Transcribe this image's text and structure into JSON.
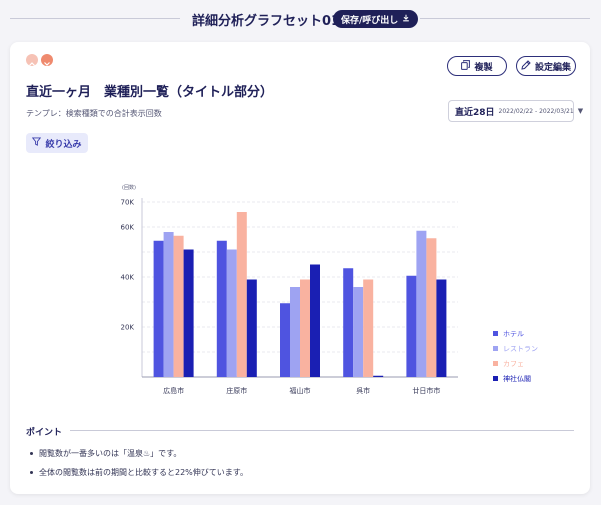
{
  "header": {
    "title": "詳細分析グラフセット01",
    "save_label": "保存/呼び出し"
  },
  "card": {
    "copy_label": "複製",
    "settings_label": "設定編集",
    "title": "直近一ヶ月　業種別一覧（タイトル部分）",
    "subtitle": "テンプレ：検索種類での合計表示回数",
    "date_label": "直近28日",
    "date_range": "2022/02/22 - 2022/03/21",
    "filter_label": "絞り込み"
  },
  "chart_data": {
    "type": "bar",
    "unit_label": "(回数)",
    "categories": [
      "広島市",
      "庄原市",
      "福山市",
      "呉市",
      "廿日市市"
    ],
    "y_ticks": [
      "20K",
      "40K",
      "60K",
      "70K"
    ],
    "y_tick_values": [
      20000,
      40000,
      60000,
      70000
    ],
    "ylim": [
      0,
      70000
    ],
    "series": [
      {
        "name": "ホテル",
        "color": "#4f54e0",
        "values": [
          54500,
          54500,
          29500,
          43500,
          40500
        ]
      },
      {
        "name": "レストラン",
        "color": "#9ea3f2",
        "values": [
          58000,
          51000,
          36000,
          36000,
          58500
        ]
      },
      {
        "name": "カフェ",
        "color": "#f9b2a0",
        "values": [
          56500,
          66000,
          39000,
          39000,
          55500
        ]
      },
      {
        "name": "神社仏閣",
        "color": "#1a1fb3",
        "values": [
          51000,
          39000,
          45000,
          500,
          39000
        ]
      }
    ],
    "grid": true,
    "legend_position": "right"
  },
  "points": {
    "title": "ポイント",
    "items": [
      "閲覧数が一番多いのは「温泉♨」です。",
      "全体の閲覧数は前の期間と比較すると22%伸びています。"
    ]
  },
  "colors": {
    "navy": "#1f2058",
    "accent": "#3a3dab"
  }
}
